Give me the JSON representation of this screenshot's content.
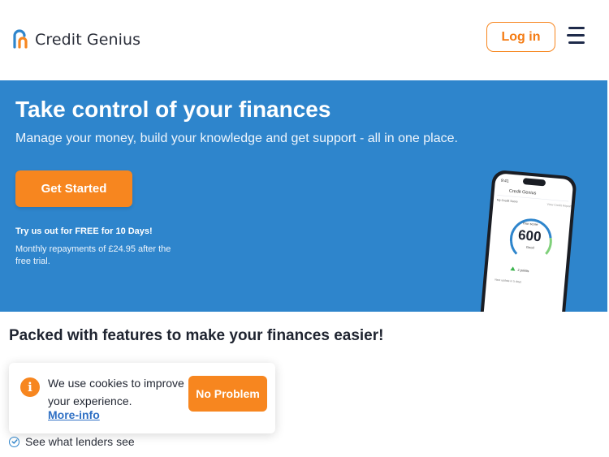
{
  "header": {
    "brand": "Credit Genius",
    "login_label": "Log in",
    "brand_color": "#f7861f",
    "logo_icon": "credit-genius-logo-icon",
    "menu_icon": "hamburger-menu-icon"
  },
  "hero": {
    "title": "Take control of your finances",
    "subtitle": "Manage your money, build your knowledge and get support - all in one place.",
    "cta_label": "Get Started",
    "trial_text": "Try us out for FREE for 10 Days!",
    "repayment_text": "Monthly repayments of £24.95 after the free trial.",
    "background_color": "#2e85cc",
    "phone": {
      "time": "9:41",
      "app_name": "Credit Genius",
      "section_label": "My Credit Score",
      "view_link": "View Credit Report",
      "score_caption": "Your score",
      "score": "600",
      "rating": "Good",
      "change_label": "2 points",
      "footer_text": "Next update in 5 days"
    }
  },
  "features": {
    "title": "Packed with features to make your finances easier!",
    "items": [
      {
        "label": "See what lenders see",
        "icon": "check-circle-icon"
      }
    ]
  },
  "cookie_banner": {
    "message": "We use cookies to improve your experience.",
    "more_info_label": "More-info",
    "accept_label": "No Problem",
    "icon": "info-icon"
  }
}
